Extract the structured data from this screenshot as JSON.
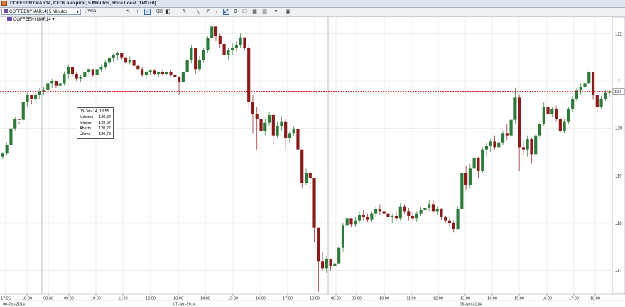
{
  "window": {
    "title": "COFFEENYMAR14, CFDs a expirar, 5 Minutos, Hora Local (TMG+0)"
  },
  "toolbar": {
    "symbol": "COFFEENYMAR14",
    "interval": "5 Minutos",
    "chart_type": "Vela",
    "icons": [
      "cursor-icon",
      "crosshair-icon",
      "box-zoom-icon",
      "eraser-icon",
      "line-draw-icon",
      "pencil-icon",
      "expand-icon",
      "settings-icon",
      "copy-icon",
      "layout-icon",
      "heart-icon",
      "window-icon"
    ]
  },
  "legend": {
    "label": "COFFEENYMAR14 ▾"
  },
  "tooltip": {
    "datetime": "08-Jan-14, 18:55",
    "rows": [
      {
        "label": "Máximo",
        "value": "120,82"
      },
      {
        "label": "Mínimo",
        "value": "120,67"
      },
      {
        "label": "Aberto",
        "value": "120,77"
      },
      {
        "label": "Último",
        "value": "120,78"
      }
    ]
  },
  "current_price": {
    "label": "120",
    "value": 120.78
  },
  "colors": {
    "up": "#2f7a3a",
    "down": "#8b1a1a",
    "line": "#cc0000",
    "grid": "#e3e3e3"
  },
  "chart_data": {
    "type": "candlestick",
    "title": "COFFEENYMAR14",
    "ylim": [
      116.5,
      122.35
    ],
    "yticks": [
      {
        "label": "122",
        "value": 122
      },
      {
        "label": "121",
        "value": 121
      },
      {
        "label": "120",
        "value": 120
      },
      {
        "label": "119",
        "value": 119
      },
      {
        "label": "118",
        "value": 118
      },
      {
        "label": "117",
        "value": 117
      }
    ],
    "xticks": [
      "17:25",
      "18:00",
      "08:30",
      "09:00",
      "10:00",
      "11:00",
      "12:00",
      "13:00",
      "14:00",
      "15:00",
      "16:00",
      "17:00",
      "18:00",
      "08:30",
      "09:00",
      "10:00",
      "11:00",
      "12:00",
      "13:00",
      "14:00",
      "15:00",
      "16:00",
      "17:00",
      "18:00"
    ],
    "dates": [
      "06-Jan-2014",
      "07-Jan-2014",
      "08-Jan-2014"
    ],
    "candles": [
      [
        119.4,
        119.5,
        119.35,
        119.48
      ],
      [
        119.48,
        119.7,
        119.44,
        119.65
      ],
      [
        119.65,
        120.05,
        119.6,
        120.0
      ],
      [
        120.0,
        120.25,
        119.95,
        120.2
      ],
      [
        120.2,
        120.15,
        120.1,
        120.18
      ],
      [
        120.18,
        120.6,
        120.12,
        120.55
      ],
      [
        120.55,
        120.75,
        120.45,
        120.7
      ],
      [
        120.7,
        120.6,
        120.52,
        120.62
      ],
      [
        120.62,
        120.75,
        120.58,
        120.7
      ],
      [
        120.7,
        120.85,
        120.62,
        120.78
      ],
      [
        120.78,
        120.88,
        120.7,
        120.82
      ],
      [
        120.82,
        121.0,
        120.75,
        120.95
      ],
      [
        120.95,
        121.05,
        120.85,
        121.0
      ],
      [
        121.0,
        121.0,
        120.85,
        120.9
      ],
      [
        120.9,
        121.0,
        120.82,
        120.95
      ],
      [
        120.95,
        121.2,
        120.9,
        121.15
      ],
      [
        121.15,
        121.35,
        121.05,
        121.3
      ],
      [
        121.3,
        121.25,
        121.1,
        121.15
      ],
      [
        121.15,
        121.2,
        121.0,
        121.05
      ],
      [
        121.05,
        121.12,
        120.98,
        121.08
      ],
      [
        121.08,
        121.22,
        121.02,
        121.18
      ],
      [
        121.18,
        121.28,
        121.12,
        121.25
      ],
      [
        121.25,
        121.2,
        121.08,
        121.12
      ],
      [
        121.12,
        121.3,
        121.08,
        121.25
      ],
      [
        121.25,
        121.35,
        121.18,
        121.3
      ],
      [
        121.3,
        121.45,
        121.25,
        121.4
      ],
      [
        121.4,
        121.52,
        121.32,
        121.48
      ],
      [
        121.48,
        121.58,
        121.4,
        121.55
      ],
      [
        121.55,
        121.62,
        121.45,
        121.6
      ],
      [
        121.6,
        121.55,
        121.45,
        121.5
      ],
      [
        121.5,
        121.45,
        121.35,
        121.4
      ],
      [
        121.4,
        121.52,
        121.35,
        121.45
      ],
      [
        121.45,
        121.4,
        121.28,
        121.32
      ],
      [
        121.32,
        121.35,
        121.2,
        121.25
      ],
      [
        121.25,
        121.3,
        121.08,
        121.12
      ],
      [
        121.12,
        121.22,
        121.05,
        121.18
      ],
      [
        121.18,
        121.25,
        121.12,
        121.22
      ],
      [
        121.22,
        121.25,
        121.12,
        121.15
      ],
      [
        121.15,
        121.2,
        121.08,
        121.18
      ],
      [
        121.18,
        121.25,
        121.1,
        121.15
      ],
      [
        121.15,
        121.2,
        121.12,
        121.18
      ],
      [
        121.18,
        121.22,
        121.1,
        121.12
      ],
      [
        121.12,
        121.18,
        121.05,
        121.08
      ],
      [
        121.08,
        121.1,
        120.7,
        120.98
      ],
      [
        120.98,
        121.2,
        120.95,
        121.18
      ],
      [
        121.18,
        121.5,
        121.12,
        121.45
      ],
      [
        121.45,
        121.75,
        121.38,
        121.7
      ],
      [
        121.7,
        121.55,
        121.15,
        121.25
      ],
      [
        121.25,
        121.52,
        121.2,
        121.45
      ],
      [
        121.45,
        121.7,
        121.4,
        121.65
      ],
      [
        121.65,
        121.95,
        121.6,
        121.9
      ],
      [
        121.9,
        122.25,
        121.85,
        122.15
      ],
      [
        122.15,
        122.1,
        121.85,
        121.95
      ],
      [
        121.95,
        122.0,
        121.7,
        121.78
      ],
      [
        121.78,
        121.8,
        121.5,
        121.55
      ],
      [
        121.55,
        121.7,
        121.45,
        121.65
      ],
      [
        121.65,
        121.8,
        121.55,
        121.7
      ],
      [
        121.7,
        121.85,
        121.62,
        121.75
      ],
      [
        121.75,
        122.0,
        121.7,
        121.92
      ],
      [
        121.92,
        121.88,
        121.65,
        121.7
      ],
      [
        121.7,
        121.78,
        120.45,
        120.55
      ],
      [
        120.55,
        120.7,
        119.9,
        120.3
      ],
      [
        120.3,
        120.45,
        119.55,
        120.2
      ],
      [
        120.2,
        120.3,
        119.75,
        119.95
      ],
      [
        119.95,
        120.2,
        119.85,
        120.12
      ],
      [
        120.12,
        120.35,
        120.05,
        120.28
      ],
      [
        120.28,
        120.35,
        119.65,
        119.85
      ],
      [
        119.85,
        120.15,
        119.8,
        120.05
      ],
      [
        120.05,
        120.25,
        119.95,
        120.15
      ],
      [
        120.15,
        120.2,
        119.55,
        119.8
      ],
      [
        119.8,
        119.95,
        119.7,
        119.9
      ],
      [
        119.9,
        120.05,
        119.85,
        119.98
      ],
      [
        119.98,
        120.0,
        119.3,
        119.55
      ],
      [
        119.55,
        119.35,
        118.75,
        118.85
      ],
      [
        118.85,
        119.15,
        118.8,
        119.05
      ],
      [
        119.05,
        119.1,
        118.7,
        118.95
      ],
      [
        118.95,
        118.8,
        117.6,
        117.9
      ],
      [
        117.9,
        117.75,
        116.55,
        117.2
      ],
      [
        117.2,
        117.4,
        117.0,
        117.05
      ],
      [
        117.05,
        117.3,
        116.95,
        117.25
      ],
      [
        117.25,
        117.2,
        117.0,
        117.1
      ],
      [
        117.1,
        117.35,
        117.05,
        117.15
      ],
      [
        117.15,
        117.55,
        117.1,
        117.48
      ],
      [
        117.48,
        118.0,
        117.4,
        117.95
      ],
      [
        117.95,
        118.15,
        117.9,
        118.1
      ],
      [
        118.1,
        118.05,
        117.92,
        117.98
      ],
      [
        117.98,
        118.12,
        117.92,
        118.05
      ],
      [
        118.05,
        118.25,
        118.0,
        118.18
      ],
      [
        118.18,
        118.28,
        118.05,
        118.12
      ],
      [
        118.12,
        118.2,
        118.02,
        118.08
      ],
      [
        118.08,
        118.25,
        118.02,
        118.2
      ],
      [
        118.2,
        118.35,
        118.12,
        118.3
      ],
      [
        118.3,
        118.4,
        118.18,
        118.25
      ],
      [
        118.25,
        118.35,
        118.15,
        118.2
      ],
      [
        118.2,
        118.3,
        118.08,
        118.12
      ],
      [
        118.12,
        118.2,
        118.0,
        118.15
      ],
      [
        118.15,
        118.25,
        118.05,
        118.1
      ],
      [
        118.1,
        118.42,
        118.05,
        118.35
      ],
      [
        118.35,
        118.4,
        118.2,
        118.25
      ],
      [
        118.25,
        118.32,
        118.05,
        118.15
      ],
      [
        118.15,
        118.22,
        118.05,
        118.1
      ],
      [
        118.1,
        118.25,
        118.02,
        118.2
      ],
      [
        118.2,
        118.35,
        118.15,
        118.28
      ],
      [
        118.28,
        118.4,
        118.2,
        118.32
      ],
      [
        118.32,
        118.48,
        118.25,
        118.4
      ],
      [
        118.4,
        118.5,
        118.2,
        118.25
      ],
      [
        118.25,
        118.35,
        118.18,
        118.3
      ],
      [
        118.3,
        118.32,
        118.08,
        118.12
      ],
      [
        118.12,
        118.15,
        118.0,
        118.05
      ],
      [
        118.05,
        118.12,
        117.9,
        118.0
      ],
      [
        118.0,
        118.05,
        117.8,
        117.88
      ],
      [
        117.88,
        118.35,
        117.85,
        118.3
      ],
      [
        118.3,
        119.1,
        118.25,
        119.05
      ],
      [
        119.05,
        119.2,
        118.7,
        118.8
      ],
      [
        118.8,
        119.25,
        118.75,
        119.15
      ],
      [
        119.15,
        119.45,
        119.05,
        119.38
      ],
      [
        119.38,
        119.4,
        118.95,
        119.1
      ],
      [
        119.1,
        119.6,
        119.05,
        119.55
      ],
      [
        119.55,
        119.7,
        119.4,
        119.62
      ],
      [
        119.62,
        119.78,
        119.5,
        119.72
      ],
      [
        119.72,
        119.85,
        119.55,
        119.6
      ],
      [
        119.6,
        119.75,
        119.5,
        119.7
      ],
      [
        119.7,
        119.95,
        119.65,
        119.9
      ],
      [
        119.9,
        120.1,
        119.75,
        119.85
      ],
      [
        119.85,
        120.25,
        119.8,
        120.18
      ],
      [
        120.18,
        120.85,
        120.1,
        120.65
      ],
      [
        120.65,
        120.72,
        119.1,
        119.6
      ],
      [
        119.6,
        119.75,
        119.45,
        119.55
      ],
      [
        119.55,
        119.85,
        119.4,
        119.78
      ],
      [
        119.78,
        119.8,
        119.25,
        119.45
      ],
      [
        119.45,
        119.9,
        119.4,
        119.85
      ],
      [
        119.85,
        120.15,
        119.8,
        120.1
      ],
      [
        120.1,
        120.55,
        120.05,
        120.45
      ],
      [
        120.45,
        120.5,
        120.2,
        120.3
      ],
      [
        120.3,
        120.45,
        120.25,
        120.4
      ],
      [
        120.4,
        120.48,
        120.15,
        120.2
      ],
      [
        120.2,
        120.25,
        119.9,
        119.95
      ],
      [
        119.95,
        120.2,
        119.9,
        120.15
      ],
      [
        120.15,
        120.45,
        120.1,
        120.4
      ],
      [
        120.4,
        120.68,
        120.35,
        120.62
      ],
      [
        120.62,
        120.85,
        120.58,
        120.8
      ],
      [
        120.8,
        120.95,
        120.7,
        120.88
      ],
      [
        120.88,
        121.0,
        120.78,
        120.95
      ],
      [
        120.95,
        121.25,
        120.9,
        121.18
      ],
      [
        121.18,
        121.1,
        120.6,
        120.7
      ],
      [
        120.7,
        120.72,
        120.35,
        120.45
      ],
      [
        120.45,
        120.68,
        120.4,
        120.62
      ],
      [
        120.62,
        120.82,
        120.58,
        120.75
      ],
      [
        120.75,
        120.82,
        120.67,
        120.78
      ]
    ]
  }
}
